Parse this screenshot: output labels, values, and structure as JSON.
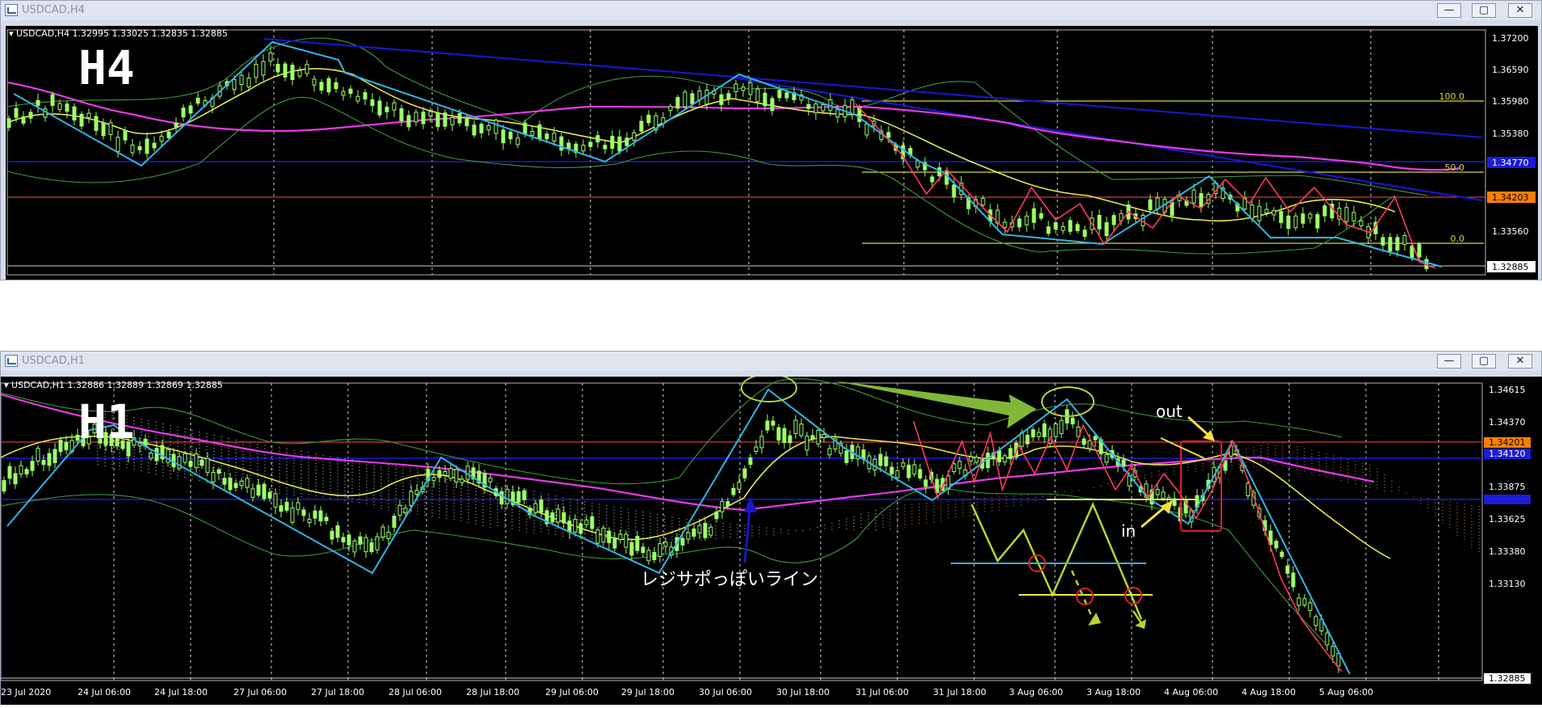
{
  "windows": {
    "h4": {
      "title": "USDCAD,H4",
      "ohlc": "USDCAD,H4  1.32995 1.33025 1.32835 1.32885",
      "label": "H4",
      "prices": [
        "1.37200",
        "1.36590",
        "1.35980",
        "1.35380",
        "1.34770",
        "1.34203",
        "1.33560",
        "1.32885"
      ],
      "fib": [
        "100.0",
        "50.0",
        "0.0"
      ]
    },
    "h1": {
      "title": "USDCAD,H1",
      "ohlc": "USDCAD,H1  1.32886 1.32889 1.32869 1.32885",
      "label": "H1",
      "prices": [
        "1.34615",
        "1.34370",
        "1.34201",
        "1.34120",
        "1.33875",
        "1.33625",
        "1.33380",
        "1.33130",
        "1.32885"
      ],
      "time_axis": [
        "23 Jul 2020",
        "24 Jul 06:00",
        "24 Jul 18:00",
        "27 Jul 06:00",
        "27 Jul 18:00",
        "28 Jul 06:00",
        "28 Jul 18:00",
        "29 Jul 06:00",
        "29 Jul 18:00",
        "30 Jul 06:00",
        "30 Jul 18:00",
        "31 Jul 06:00",
        "31 Jul 18:00",
        "3 Aug 06:00",
        "3 Aug 18:00",
        "4 Aug 06:00",
        "4 Aug 18:00",
        "5 Aug 06:00"
      ],
      "annotations": {
        "out": "out",
        "in": "in",
        "line_note": "レジサポっぽいライン"
      }
    }
  },
  "buttons": {
    "minimize": "—",
    "restore": "▢",
    "close": "✕"
  },
  "colors": {
    "background": "#000000",
    "candle": "#9dff6a",
    "zigzag": "#2fb6e6",
    "trendline": "#1717c8",
    "ma_yellow": "#e6e651",
    "ma_magenta": "#e63ae6",
    "band": "#3e9a3e",
    "level_orange": "#ff7f00",
    "level_blue": "#1b1bd8"
  }
}
